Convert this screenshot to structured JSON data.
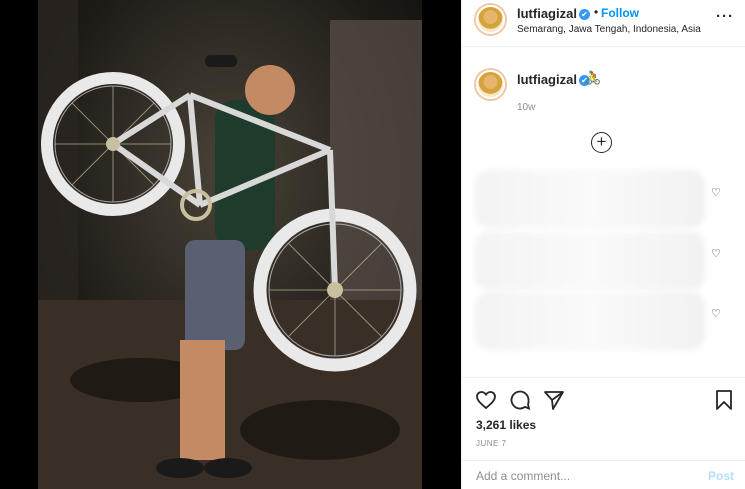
{
  "header": {
    "username": "lutfiagizal",
    "verified_icon": "✔",
    "separator": "•",
    "follow_label": "Follow",
    "location": "Semarang, Jawa Tengah, Indonesia, Asia",
    "more_label": "···"
  },
  "caption": {
    "username": "lutfiagizal",
    "text": "🚴",
    "time": "10w"
  },
  "load_more_icon": "+",
  "comments": [
    {
      "heart": "♡"
    },
    {
      "heart": "♡"
    },
    {
      "heart": "♡"
    }
  ],
  "actions": {
    "likes": "3,261 likes",
    "date": "JUNE 7"
  },
  "comment_bar": {
    "placeholder": "Add a comment...",
    "post_label": "Post"
  },
  "colors": {
    "accent": "#0095f6",
    "verified": "#3897f0",
    "bike_frame": "#c9c0a0",
    "rim": "#e9e9e9"
  },
  "icons": [
    "heart-icon",
    "comment-icon",
    "share-icon",
    "bookmark-icon",
    "more-options-icon",
    "add-circle-icon",
    "verified-badge-icon"
  ]
}
